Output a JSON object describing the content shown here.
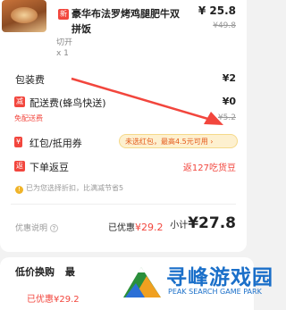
{
  "product": {
    "tag": "新",
    "name": "豪华布法罗烤鸡腿肥牛双拼饭",
    "spec": "切开",
    "qty": "x 1",
    "price": "¥ 25.8",
    "orig_price": "¥49.8"
  },
  "packing": {
    "label": "包装费",
    "value": "¥2"
  },
  "delivery": {
    "tag": "减",
    "label": "配送费(蜂鸟快送)",
    "value": "¥0",
    "free_label": "免配送费",
    "orig_value": "¥5.2"
  },
  "redpacket": {
    "tag": "¥",
    "label": "红包/抵用券",
    "pill": "未选红包，最高4.5元可用 ›"
  },
  "cashback": {
    "tag": "返",
    "label": "下单返豆",
    "value": "返127吃货豆"
  },
  "note": {
    "icon": "!",
    "text": "已为您选择折扣，比满减节省5"
  },
  "summary": {
    "help": "优惠说明",
    "help_icon": "?",
    "discount_label": "已优惠",
    "discount": "¥29.2",
    "subtotal_label": "小计",
    "subtotal": "¥27.8"
  },
  "bottom": {
    "title": "低价换购",
    "title2": "最",
    "discount_label": "已优惠",
    "discount": "¥29.2"
  },
  "watermark": {
    "cn": "寻峰游戏园",
    "en": "PEAK SEARCH GAME PARK"
  },
  "colors": {
    "accent": "#f2463d",
    "pill_bg": "#fdf0cf"
  }
}
